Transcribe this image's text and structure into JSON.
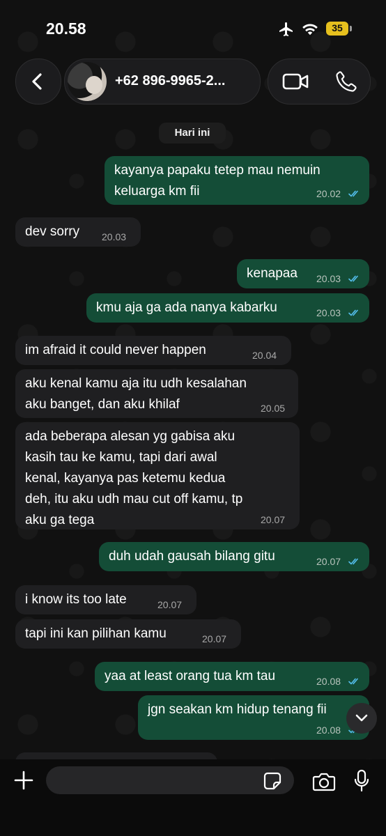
{
  "status_bar": {
    "time": "20.58",
    "battery": "35"
  },
  "header": {
    "contact_name": "+62 896-9965-2..."
  },
  "date_chip": "Hari ini",
  "messages": [
    {
      "dir": "out",
      "lines": [
        "kayanya papaku tetep mau nemuin",
        "keluarga km fii"
      ],
      "time": "20.02",
      "read": true
    },
    {
      "dir": "in",
      "lines": [
        "dev sorry"
      ],
      "time": "20.03"
    },
    {
      "dir": "out",
      "lines": [
        "kenapaa"
      ],
      "time": "20.03",
      "read": true
    },
    {
      "dir": "out",
      "lines": [
        "kmu aja ga ada nanya kabarku"
      ],
      "time": "20.03",
      "read": true
    },
    {
      "dir": "in",
      "lines": [
        "im afraid it could never happen"
      ],
      "time": "20.04"
    },
    {
      "dir": "in",
      "lines": [
        "aku kenal kamu aja itu udh kesalahan",
        "aku banget, dan aku khilaf"
      ],
      "time": "20.05"
    },
    {
      "dir": "in",
      "lines": [
        "ada beberapa alesan yg gabisa aku",
        "kasih tau ke kamu, tapi dari awal",
        "kenal, kayanya pas ketemu kedua",
        "deh, itu aku udh mau cut off kamu, tp",
        "aku ga tega"
      ],
      "time": "20.07"
    },
    {
      "dir": "out",
      "lines": [
        "duh udah gausah bilang gitu"
      ],
      "time": "20.07",
      "read": true
    },
    {
      "dir": "in",
      "lines": [
        "i know its too late"
      ],
      "time": "20.07"
    },
    {
      "dir": "in",
      "lines": [
        "tapi ini kan pilihan kamu"
      ],
      "time": "20.07"
    },
    {
      "dir": "out",
      "lines": [
        "yaa at least orang tua km tau"
      ],
      "time": "20.08",
      "read": true
    },
    {
      "dir": "out",
      "lines": [
        "jgn seakan km hidup tenang fii"
      ],
      "time": "20.08",
      "read": true
    }
  ],
  "input": {
    "placeholder": ""
  },
  "colors": {
    "incoming": "#1f1f21",
    "outgoing": "#144d37",
    "read_ticks": "#53bdeb"
  },
  "icons": [
    "back-chevron-icon",
    "video-call-icon",
    "phone-icon",
    "plus-icon",
    "sticker-icon",
    "camera-icon",
    "mic-icon",
    "chevron-down-icon",
    "airplane-icon",
    "wifi-icon"
  ]
}
